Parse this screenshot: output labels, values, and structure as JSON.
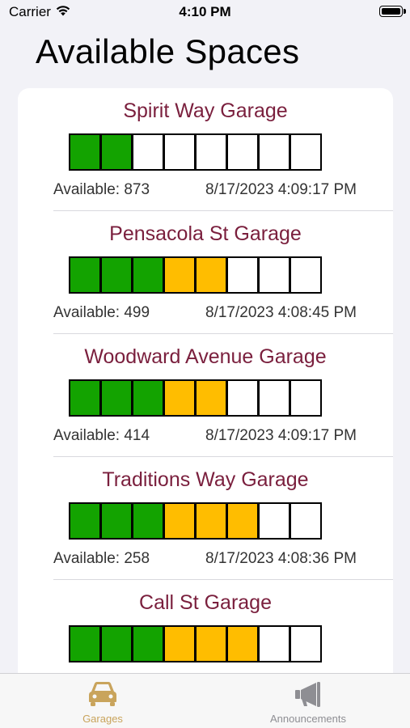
{
  "status": {
    "carrier": "Carrier",
    "time": "4:10 PM"
  },
  "title": "Available Spaces",
  "colors": {
    "green": "#13a300",
    "yellow": "#ffbd00",
    "empty": "#ffffff",
    "title": "#7a1f3d",
    "accent": "#c9a45c",
    "inactive": "#8e8e93"
  },
  "garages": [
    {
      "name": "Spirit Way Garage",
      "available": "Available: 873",
      "timestamp": "8/17/2023 4:09:17 PM",
      "segments": [
        "green",
        "green",
        "empty",
        "empty",
        "empty",
        "empty",
        "empty",
        "empty"
      ]
    },
    {
      "name": "Pensacola St Garage",
      "available": "Available: 499",
      "timestamp": "8/17/2023 4:08:45 PM",
      "segments": [
        "green",
        "green",
        "green",
        "yellow",
        "yellow",
        "empty",
        "empty",
        "empty"
      ]
    },
    {
      "name": "Woodward Avenue Garage",
      "available": "Available: 414",
      "timestamp": "8/17/2023 4:09:17 PM",
      "segments": [
        "green",
        "green",
        "green",
        "yellow",
        "yellow",
        "empty",
        "empty",
        "empty"
      ]
    },
    {
      "name": "Traditions Way Garage",
      "available": "Available: 258",
      "timestamp": "8/17/2023 4:08:36 PM",
      "segments": [
        "green",
        "green",
        "green",
        "yellow",
        "yellow",
        "yellow",
        "empty",
        "empty"
      ]
    },
    {
      "name": "Call St Garage",
      "available": "",
      "timestamp": "",
      "segments": [
        "green",
        "green",
        "green",
        "yellow",
        "yellow",
        "yellow",
        "empty",
        "empty"
      ]
    }
  ],
  "tabs": [
    {
      "label": "Garages",
      "icon": "car-icon",
      "active": true
    },
    {
      "label": "Announcements",
      "icon": "megaphone-icon",
      "active": false
    }
  ]
}
